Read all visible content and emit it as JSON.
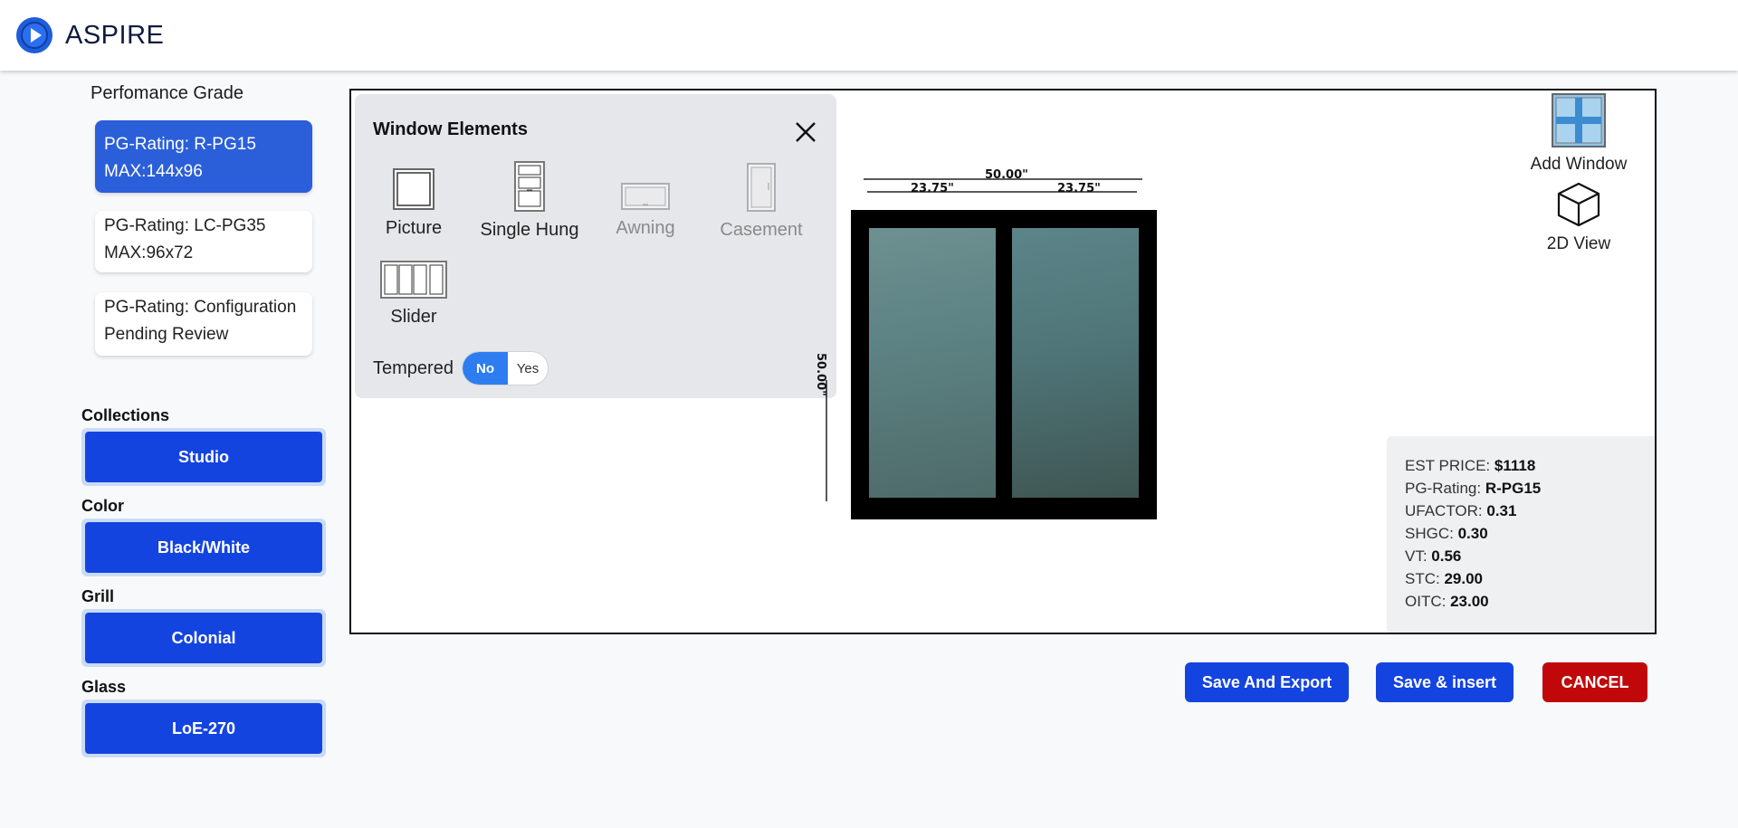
{
  "app": {
    "title": "ASPIRE"
  },
  "performance": {
    "title": "Perfomance Grade",
    "cards": [
      {
        "line1": "PG-Rating: R-PG15",
        "line2": "MAX:144x96",
        "active": true
      },
      {
        "line1": "PG-Rating: LC-PG35",
        "line2": "MAX:96x72",
        "active": false
      },
      {
        "line1": "PG-Rating: Configuration",
        "line2": "Pending Review",
        "active": false
      }
    ]
  },
  "options": {
    "collections": {
      "label": "Collections",
      "value": "Studio"
    },
    "color": {
      "label": "Color",
      "value": "Black/White"
    },
    "grill": {
      "label": "Grill",
      "value": "Colonial"
    },
    "glass": {
      "label": "Glass",
      "value": "LoE-270"
    }
  },
  "window_elements": {
    "title": "Window Elements",
    "items": [
      {
        "label": "Picture",
        "icon": "picture-window-icon",
        "enabled": true
      },
      {
        "label": "Single Hung",
        "icon": "single-hung-window-icon",
        "enabled": true
      },
      {
        "label": "Awning",
        "icon": "awning-window-icon",
        "enabled": false
      },
      {
        "label": "Casement",
        "icon": "casement-window-icon",
        "enabled": false
      },
      {
        "label": "Slider",
        "icon": "slider-window-icon",
        "enabled": true
      }
    ],
    "tempered": {
      "label": "Tempered",
      "no": "No",
      "yes": "Yes",
      "selected": "No"
    }
  },
  "drawing": {
    "total_width": "50.00\"",
    "left_width": "23.75\"",
    "right_width": "23.75\"",
    "height": "50.00\""
  },
  "tools": {
    "add_window": "Add Window",
    "view_2d": "2D View"
  },
  "info": {
    "price_label": "EST PRICE:",
    "price": "$1118",
    "pg_label": "PG-Rating:",
    "pg": "R-PG15",
    "ufactor_label": "UFACTOR:",
    "ufactor": "0.31",
    "shgc_label": "SHGC:",
    "shgc": "0.30",
    "vt_label": "VT:",
    "vt": "0.56",
    "stc_label": "STC:",
    "stc": "29.00",
    "oitc_label": "OITC:",
    "oitc": "23.00"
  },
  "actions": {
    "save_export": "Save And Export",
    "save_insert": "Save & insert",
    "cancel": "CANCEL"
  },
  "colors": {
    "primary": "#1444e0",
    "active_card": "#2b5fd9",
    "cancel": "#c0080a",
    "toggle_on": "#2d7df0"
  }
}
